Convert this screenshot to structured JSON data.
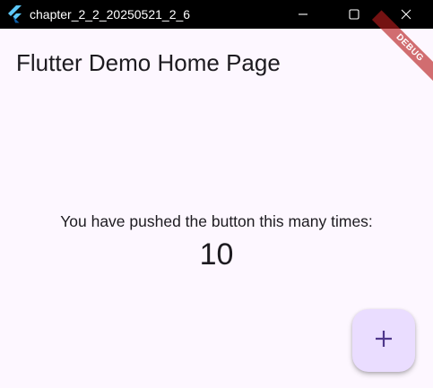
{
  "window": {
    "title": "chapter_2_2_20250521_2_6",
    "app_icon": "flutter-logo-icon",
    "controls": {
      "minimize_icon": "minimize-icon",
      "maximize_icon": "maximize-icon",
      "close_icon": "close-icon"
    }
  },
  "app_bar": {
    "title": "Flutter Demo Home Page"
  },
  "body": {
    "message": "You have pushed the button this many times:",
    "counter": "10"
  },
  "fab": {
    "icon": "plus-icon"
  },
  "debug_banner": {
    "label": "DEBUG"
  },
  "colors": {
    "background": "#fdf7ff",
    "titlebar": "#000000",
    "fab": "#eaddff",
    "fab_icon": "#4f378b",
    "debug_banner": "#b71c1c"
  }
}
